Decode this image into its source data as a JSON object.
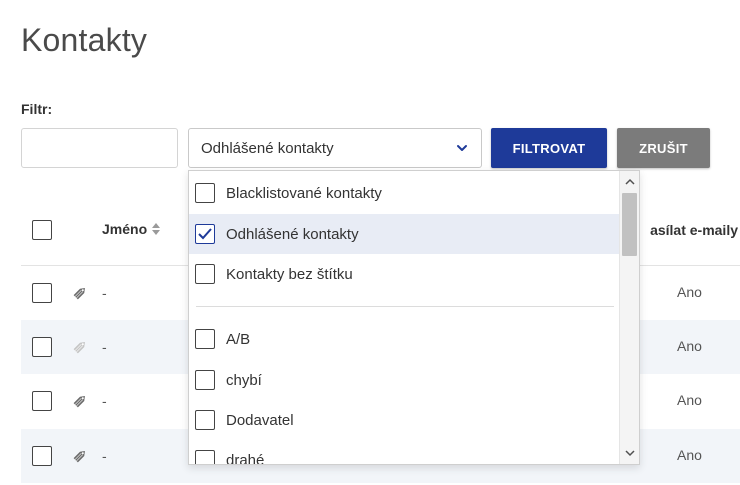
{
  "page": {
    "title": "Kontakty"
  },
  "filter": {
    "label": "Filtr:",
    "text_value": "",
    "select_value": "Odhlášené kontakty",
    "filter_button": "FILTROVAT",
    "cancel_button": "ZRUŠIT"
  },
  "table": {
    "columns": {
      "name": "Jméno",
      "send_emails": "asílat e-maily"
    },
    "rows": [
      {
        "name": "-",
        "send_emails": "Ano",
        "tag_active": true
      },
      {
        "name": "-",
        "send_emails": "Ano",
        "tag_active": false
      },
      {
        "name": "-",
        "send_emails": "Ano",
        "tag_active": true
      },
      {
        "name": "-",
        "send_emails": "Ano",
        "tag_active": true
      }
    ]
  },
  "dropdown": {
    "items": [
      {
        "label": "Blacklistované kontakty",
        "checked": false
      },
      {
        "label": "Odhlášené kontakty",
        "checked": true
      },
      {
        "label": "Kontakty bez štítku",
        "checked": false
      },
      {
        "label": "A/B",
        "checked": false
      },
      {
        "label": "chybí",
        "checked": false
      },
      {
        "label": "Dodavatel",
        "checked": false
      },
      {
        "label": "drahé",
        "checked": false
      }
    ],
    "scroll_position": 0.0
  },
  "colors": {
    "primary": "#1e3a99",
    "secondary_button": "#7b7b7b",
    "row_alt": "#f2f5f9",
    "selected_item": "#e8ecf5"
  },
  "icons": {
    "select_chevron": "chevron-down-icon",
    "sort": "sort-icon",
    "row_tag": "tag-icon",
    "checkmark": "check-icon"
  }
}
